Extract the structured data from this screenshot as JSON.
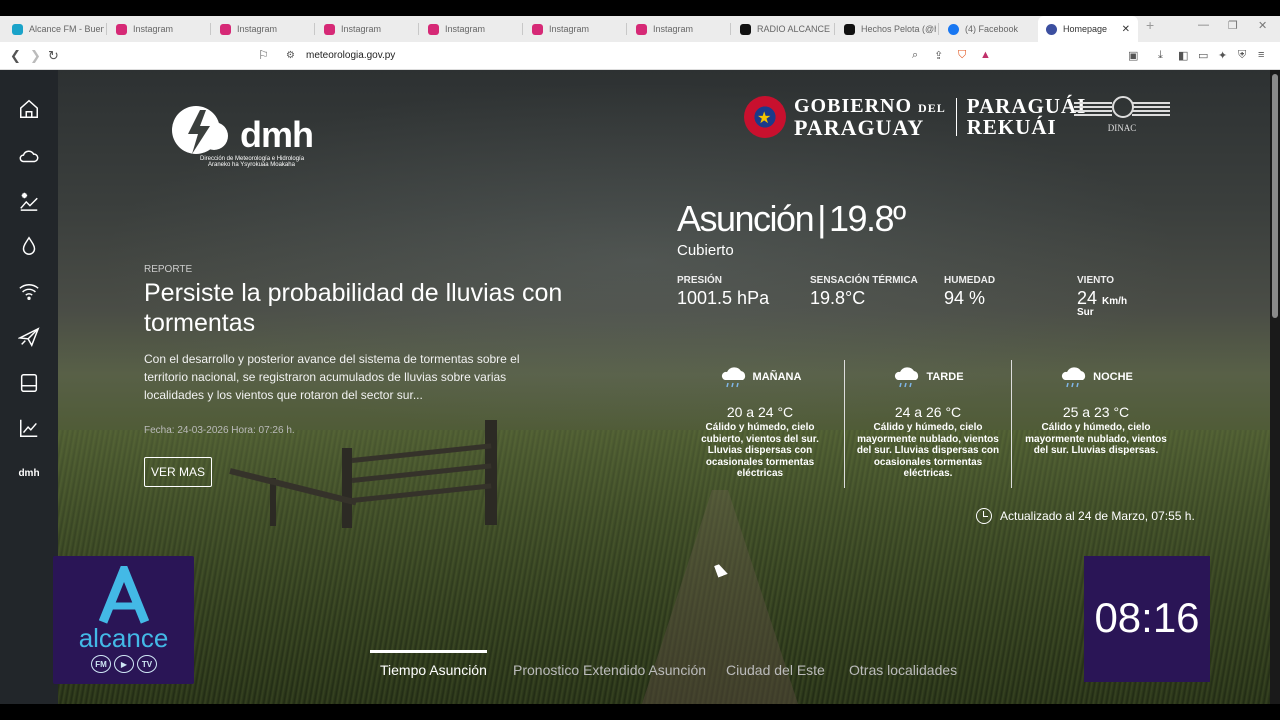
{
  "browser": {
    "tabs": [
      {
        "label": "Alcance FM - Buena",
        "color": "#1aa3c9"
      },
      {
        "label": "Instagram",
        "color": "#d62976"
      },
      {
        "label": "Instagram",
        "color": "#d62976"
      },
      {
        "label": "Instagram",
        "color": "#d62976"
      },
      {
        "label": "Instagram",
        "color": "#d62976"
      },
      {
        "label": "Instagram",
        "color": "#d62976"
      },
      {
        "label": "Instagram",
        "color": "#d62976"
      },
      {
        "label": "RADIO ALCANCE FM",
        "color": "#111111"
      },
      {
        "label": "Hechos Pelota (@ho",
        "color": "#111111"
      },
      {
        "label": "(4) Facebook",
        "color": "#1877f2"
      },
      {
        "label": "Homepage - DMH",
        "color": "#3c4fa0"
      }
    ],
    "url": "meteorologia.gov.py"
  },
  "sidebar": {
    "items": [
      "home-icon",
      "cloud-icon",
      "climate-icon",
      "drop-icon",
      "wifi-icon",
      "plane-icon",
      "tablet-icon",
      "chart-icon"
    ],
    "text_item": "dmh"
  },
  "logos": {
    "dmh_word": "dmh",
    "dmh_sub1": "Dirección de Meteorología e Hidrología",
    "dmh_sub2": "Araneko ha Ysyrokuaa Moakaha",
    "gov_line1": "GOBIERNO",
    "gov_line1_small": "DEL",
    "gov_line2": "PARAGUAY",
    "gov_right1": "PARAGUÁI",
    "gov_right2": "REKUÁI",
    "dinac": "DINAC"
  },
  "report": {
    "kicker": "REPORTE",
    "title": "Persiste la probabilidad de lluvias con tormentas",
    "description": "Con el desarrollo y posterior avance del sistema de tormentas sobre el territorio nacional, se registraron acumulados de lluvias sobre varias localidades y los vientos que rotaron del sector sur...",
    "date": "Fecha: 24-03-2026 Hora: 07:26 h.",
    "button": "VER MAS"
  },
  "weather": {
    "city": "Asunción",
    "separator": "|",
    "temp": "19.8º",
    "condition": "Cubierto",
    "stats": [
      {
        "label": "PRESIÓN",
        "value": "1001.5 hPa"
      },
      {
        "label": "SENSACIÓN TÉRMICA",
        "value": "19.8°C"
      },
      {
        "label": "HUMEDAD",
        "value": "94 %"
      },
      {
        "label": "VIENTO",
        "value": "24",
        "unit": "Km/h",
        "dir": "Sur"
      }
    ],
    "periods": [
      {
        "name": "MAÑANA",
        "range": "20 a 24 °C",
        "text": "Cálido y húmedo, cielo cubierto, vientos del sur. Lluvias dispersas con ocasionales tormentas eléctricas"
      },
      {
        "name": "TARDE",
        "range": "24 a 26 °C",
        "text": "Cálido y húmedo, cielo mayormente nublado, vientos del sur. Lluvias dispersas con ocasionales tormentas eléctricas."
      },
      {
        "name": "NOCHE",
        "range": "25 a 23 °C",
        "text": "Cálido y húmedo, cielo mayormente nublado, vientos del sur. Lluvias dispersas."
      }
    ],
    "updated": "Actualizado al 24 de Marzo, 07:55 h."
  },
  "page_tabs": [
    "Tiempo Asunción",
    "Pronostico Extendido Asunción",
    "Ciudad del Este",
    "Otras localidades"
  ],
  "overlay": {
    "brand": "alcance",
    "pills": [
      "FM",
      "▶",
      "TV"
    ],
    "time": "08:16",
    "bg_color": "#2a1556"
  }
}
